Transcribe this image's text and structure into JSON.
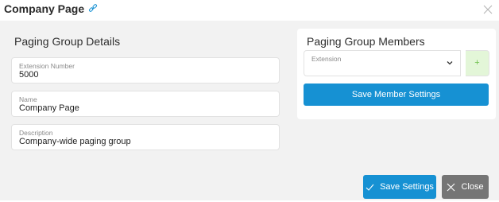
{
  "header": {
    "title": "Company Page",
    "link_icon": "link-icon",
    "close_icon": "close-icon"
  },
  "details": {
    "title": "Paging Group Details",
    "fields": [
      {
        "label": "Extension Number",
        "value": "5000"
      },
      {
        "label": "Name",
        "value": "Company Page"
      },
      {
        "label": "Description",
        "value": "Company-wide paging group"
      }
    ]
  },
  "members": {
    "title": "Paging Group Members",
    "extension_label": "Extension",
    "add_label": "+",
    "save_label": "Save Member Settings"
  },
  "footer": {
    "save_label": "Save Settings",
    "close_label": "Close"
  },
  "colors": {
    "primary": "#1691d3",
    "secondary": "#757575",
    "add_bg": "#e3f6d8",
    "add_fg": "#6cbf4a",
    "link": "#1691d3"
  }
}
